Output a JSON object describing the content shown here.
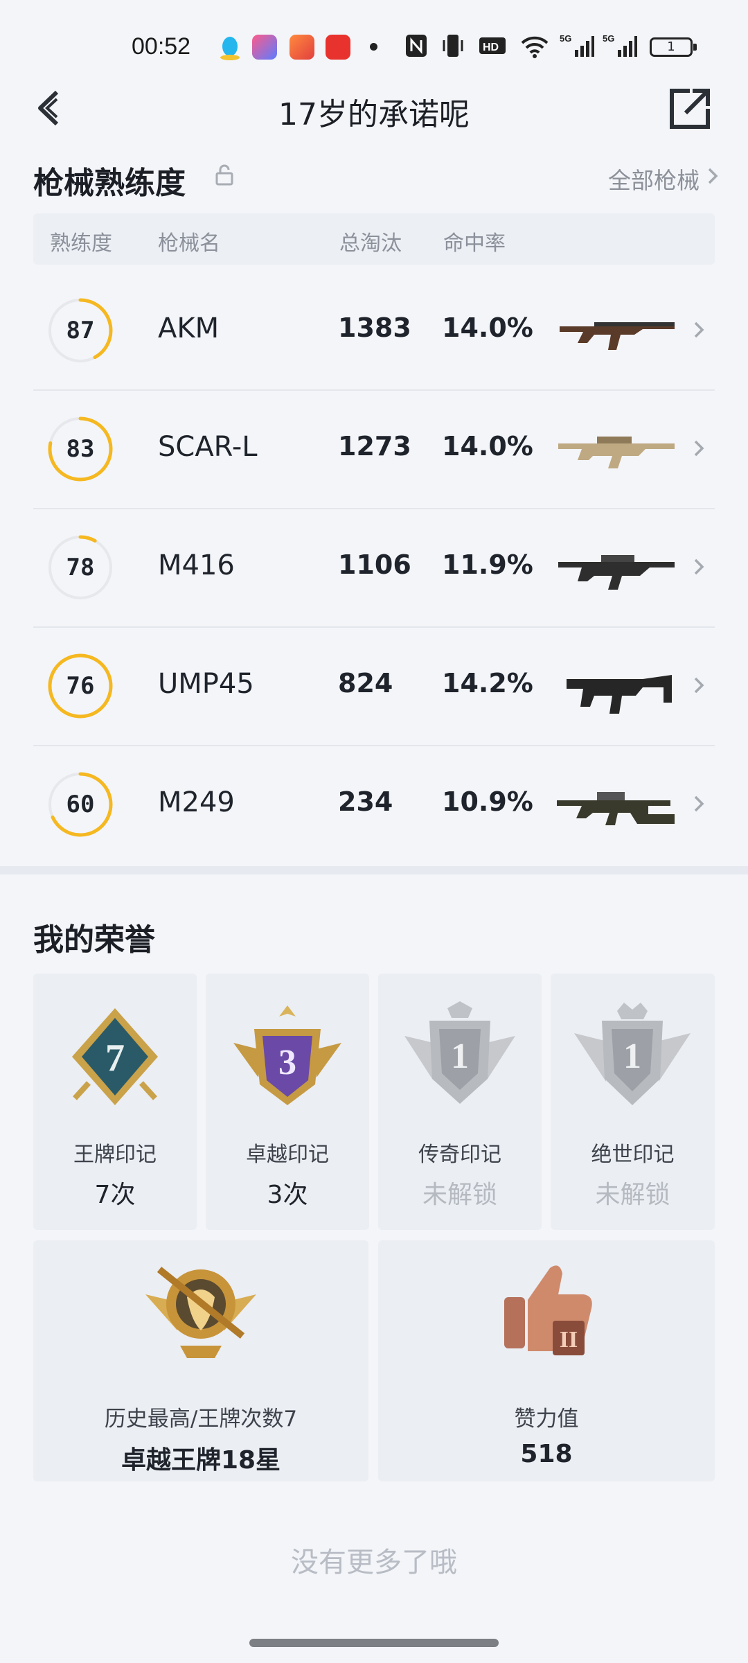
{
  "status_bar": {
    "time": "00:52",
    "battery": "1",
    "icons": [
      "qq-icon",
      "photos-app-icon",
      "game-app-icon",
      "red-packet-icon",
      "notification-dot",
      "nfc-icon",
      "vibrate-icon",
      "hd-icon",
      "wifi-icon",
      "5g-signal-icon",
      "5g-signal-icon",
      "battery-icon"
    ]
  },
  "header": {
    "title": "17岁的承诺呢",
    "back_icon": "chevron-left-icon",
    "share_icon": "share-external-icon"
  },
  "weapons": {
    "title": "枪械熟练度",
    "all_label": "全部枪械",
    "columns": {
      "proficiency": "熟练度",
      "name": "枪械名",
      "kills": "总淘汰",
      "accuracy": "命中率"
    },
    "accent": "#f5b820",
    "rows": [
      {
        "proficiency": "87",
        "name": "AKM",
        "kills": "1383",
        "accuracy": "14.0%",
        "ring_fraction": 0.42
      },
      {
        "proficiency": "83",
        "name": "SCAR-L",
        "kills": "1273",
        "accuracy": "14.0%",
        "ring_fraction": 0.78
      },
      {
        "proficiency": "78",
        "name": "M416",
        "kills": "1106",
        "accuracy": "11.9%",
        "ring_fraction": 0.08
      },
      {
        "proficiency": "76",
        "name": "UMP45",
        "kills": "824",
        "accuracy": "14.2%",
        "ring_fraction": 1.0
      },
      {
        "proficiency": "60",
        "name": "M249",
        "kills": "234",
        "accuracy": "10.9%",
        "ring_fraction": 0.68
      }
    ]
  },
  "honors": {
    "title": "我的荣誉",
    "badges": [
      {
        "label": "王牌印记",
        "value": "7次",
        "number": "7",
        "locked": false
      },
      {
        "label": "卓越印记",
        "value": "3次",
        "number": "3",
        "locked": false
      },
      {
        "label": "传奇印记",
        "value": "未解锁",
        "number": "1",
        "locked": true
      },
      {
        "label": "绝世印记",
        "value": "未解锁",
        "number": "1",
        "locked": true
      }
    ],
    "highest": {
      "label": "历史最高/王牌次数7",
      "value": "卓越王牌18星"
    },
    "likes": {
      "label": "赞力值",
      "value": "518"
    }
  },
  "footer": {
    "no_more": "没有更多了哦"
  }
}
